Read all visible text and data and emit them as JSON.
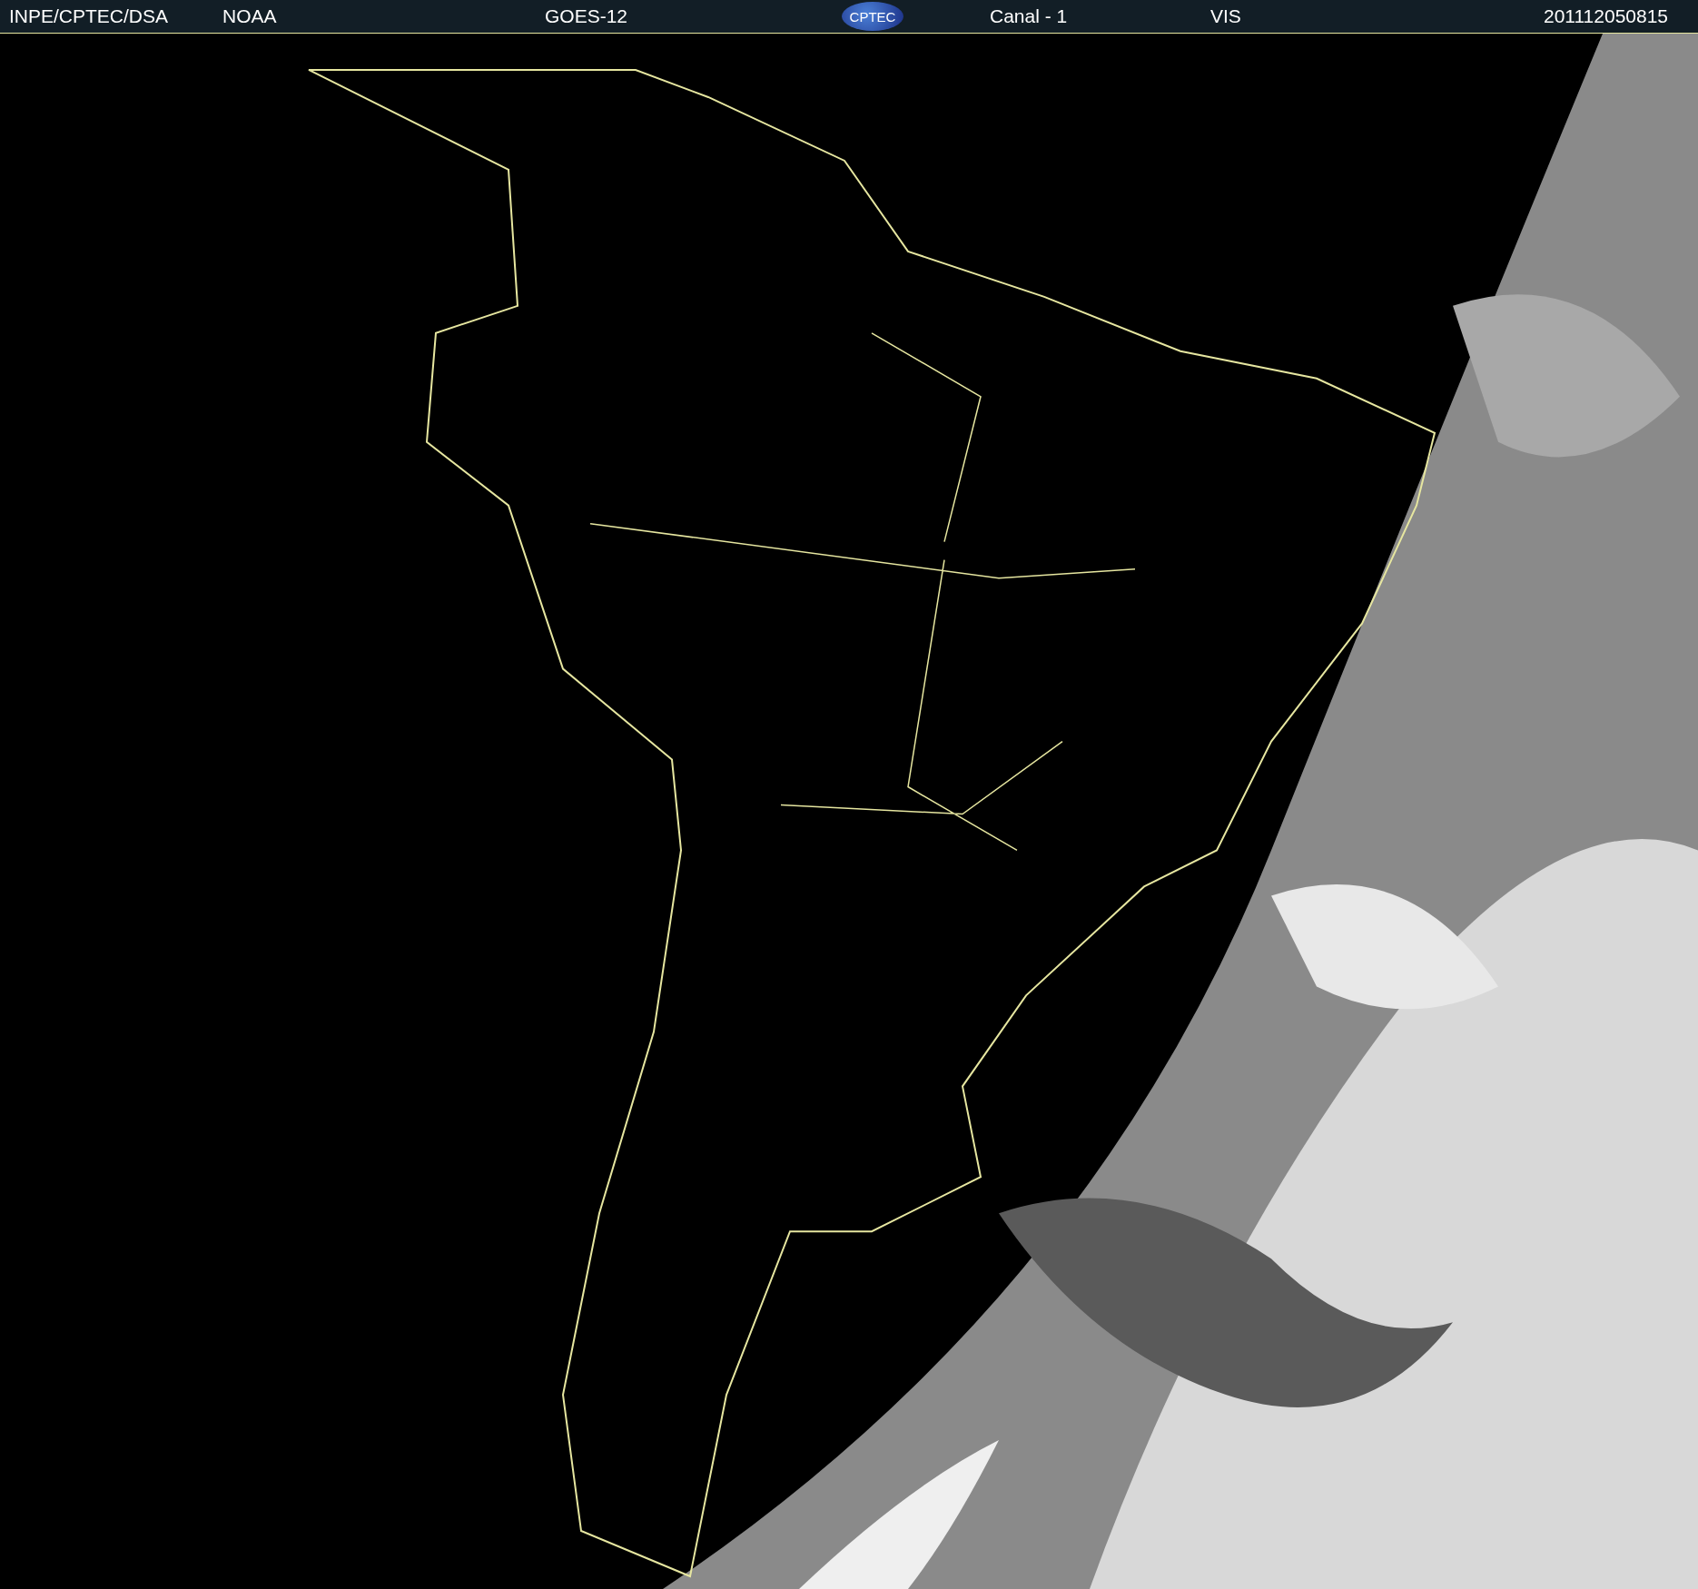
{
  "header": {
    "source": "INPE/CPTEC/DSA",
    "agency": "NOAA",
    "satellite": "GOES-12",
    "logo": "CPTEC",
    "channel": "Canal - 1",
    "band": "VIS",
    "timestamp": "201112050815"
  }
}
